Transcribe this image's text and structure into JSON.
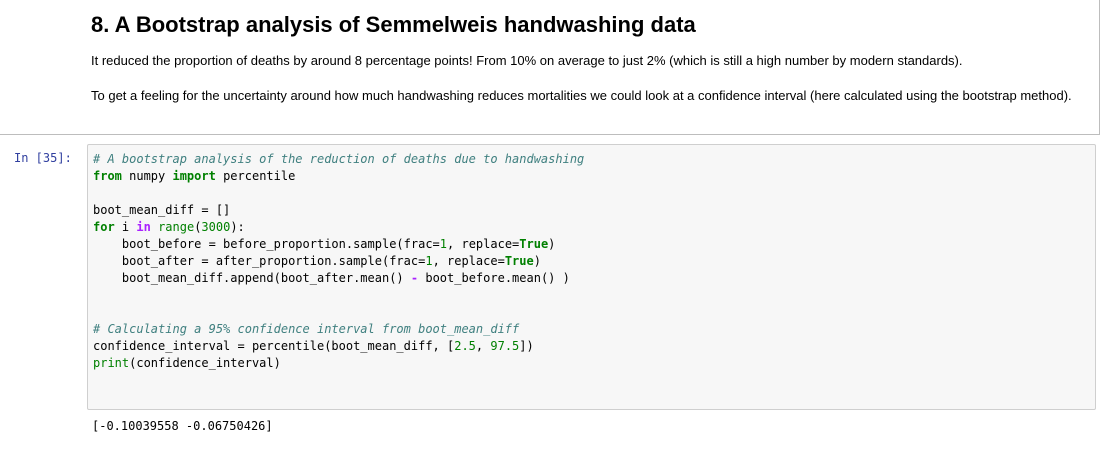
{
  "markdown": {
    "heading": "8. A Bootstrap analysis of Semmelweis handwashing data",
    "paragraph1": "It reduced the proportion of deaths by around 8 percentage points! From 10% on average to just 2% (which is still a high number by modern standards).",
    "paragraph2": "To get a feeling for the uncertainty around how much handwashing reduces mortalities we could look at a confidence interval (here calculated using the bootstrap method)."
  },
  "cell": {
    "prompt": "In [35]:",
    "lines": {
      "c1": "# A bootstrap analysis of the reduction of deaths due to handwashing",
      "l2_kw1": "from",
      "l2_mod": " numpy ",
      "l2_kw2": "import",
      "l2_name": " percentile",
      "l4": "boot_mean_diff = []",
      "l5_for": "for",
      "l5_i": " i ",
      "l5_in": "in",
      "l5_sp": " ",
      "l5_range": "range",
      "l5_open": "(",
      "l5_num": "3000",
      "l5_close": "):",
      "l6_a": "    boot_before = before_proportion.sample(frac=",
      "l6_n": "1",
      "l6_b": ", replace=",
      "l6_t": "True",
      "l6_c": ")",
      "l7_a": "    boot_after = after_proportion.sample(frac=",
      "l7_n": "1",
      "l7_b": ", replace=",
      "l7_t": "True",
      "l7_c": ")",
      "l8_a": "    boot_mean_diff.append(boot_after.mean() ",
      "l8_op": "-",
      "l8_b": " boot_before.mean() )",
      "c2": "# Calculating a 95% confidence interval from boot_mean_diff",
      "l12_a": "confidence_interval = percentile(boot_mean_diff, [",
      "l12_n1": "2.5",
      "l12_b": ", ",
      "l12_n2": "97.5",
      "l12_c": "])",
      "l13_print": "print",
      "l13_rest": "(confidence_interval)"
    }
  },
  "output": "[-0.10039558 -0.06750426]",
  "colors": {
    "comment": "#408080",
    "keyword": "#008000",
    "operator": "#aa22ff",
    "prompt": "#303f9f",
    "code_bg": "#f7f7f7"
  }
}
